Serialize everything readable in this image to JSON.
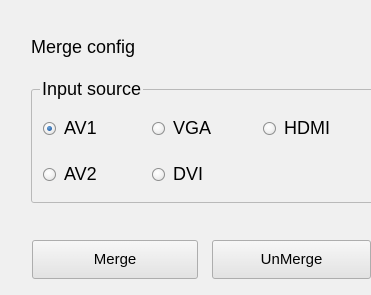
{
  "panel": {
    "title": "Merge config"
  },
  "input_source": {
    "legend": "Input source",
    "options": [
      {
        "label": "AV1",
        "selected": true
      },
      {
        "label": "VGA",
        "selected": false
      },
      {
        "label": "HDMI",
        "selected": false
      },
      {
        "label": "AV2",
        "selected": false
      },
      {
        "label": "DVI",
        "selected": false
      }
    ]
  },
  "buttons": {
    "merge_label": "Merge",
    "unmerge_label": "UnMerge"
  }
}
